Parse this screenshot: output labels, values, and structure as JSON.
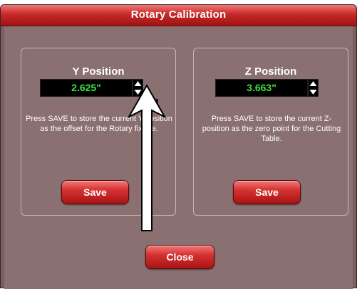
{
  "window": {
    "title": "Rotary Calibration"
  },
  "y_panel": {
    "title": "Y Position",
    "value": "2.625\"",
    "description": "Press SAVE to store the current Y-position as the offset for the Rotary fixture.",
    "save_label": "Save"
  },
  "z_panel": {
    "title": "Z Position",
    "value": "3.663\"",
    "description": "Press SAVE to store the current Z-position as the zero point for the Cutting Table.",
    "save_label": "Save"
  },
  "close_label": "Close",
  "icons": {
    "spinner": "up-down-arrows-icon",
    "nudge": "left-right-arrows-icon",
    "annotation": "white-arrow-icon"
  },
  "colors": {
    "accent": "#c72828",
    "value_text": "#3fe03f",
    "background": "#8a7070"
  }
}
